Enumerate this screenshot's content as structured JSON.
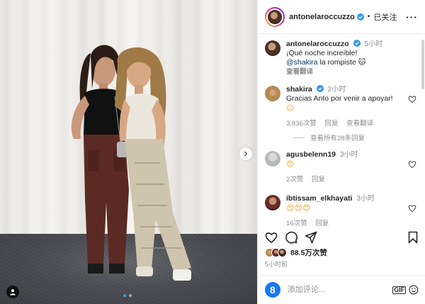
{
  "post": {
    "author": "antonelaroccuzzo",
    "follow_status": "已关注",
    "more_icon": "more-horizontal-icon"
  },
  "caption": {
    "username": "antonelaroccuzzo",
    "time": "5小时",
    "text_line1": "¡Qué noche increíble!",
    "mention": "@shakira",
    "text_line2_rest": "la rompiste",
    "translate_label": "查看翻译"
  },
  "comments": [
    {
      "username": "shakira",
      "verified": true,
      "time": "2小时",
      "text": "Gracias Anto por venir a apoyar!",
      "emoji": "☺",
      "likes": "3,836次赞",
      "reply_label": "回复",
      "translate_label": "查看翻译",
      "view_replies": "查看所有28条回复"
    },
    {
      "username": "agusbelenn19",
      "time": "3小时",
      "emoji": "😍",
      "likes": "2次赞",
      "reply_label": "回复"
    },
    {
      "username": "ibtissam_elkhayati",
      "time": "3小时",
      "emoji": "😍😍😍",
      "likes": "16次赞",
      "reply_label": "回复"
    }
  ],
  "engagement": {
    "likes_count": "88.5万次赞",
    "posted_time": "5小时前"
  },
  "add_comment": {
    "placeholder": "添加评论...",
    "gif_label": "GIF"
  },
  "carousel": {
    "total_slides": 2,
    "current_slide": 1
  },
  "colors": {
    "verified_blue": "#3897f0",
    "link_blue": "#00376b",
    "meta_gray": "#8e8e8e"
  }
}
